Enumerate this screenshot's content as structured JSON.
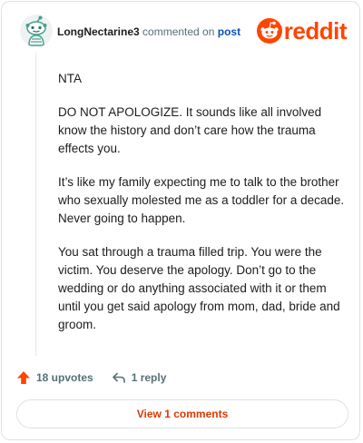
{
  "comment": {
    "username": "LongNectarine3",
    "commented_text": "commented on",
    "post_link": "post",
    "brand": "reddit",
    "paragraphs": [
      "NTA",
      "DO NOT APOLOGIZE. It sounds like all involved know the history and don’t care how the trauma effects you.",
      "It’s like my family expecting me to talk to the brother who sexually molested me as a toddler for a decade. Never going to happen.",
      "You sat through a trauma filled trip. You were the victim. You deserve the apology. Don’t go to the wedding or do anything associated with it or them until you get said apology from mom, dad, bride and groom."
    ]
  },
  "actions": {
    "upvotes": "18 upvotes",
    "replies": "1 reply",
    "view_comments": "View 1 comments"
  },
  "colors": {
    "brand_orange": "#ff4500",
    "link_blue": "#0b51b7",
    "view_button_text": "#d93900",
    "muted_text": "#576f76",
    "avatar_teal": "#46a18f"
  },
  "icons": {
    "avatar": "snoo-avatar-icon",
    "logo": "reddit-snoo-icon",
    "upvote": "upvote-arrow-icon",
    "reply": "reply-arrow-icon"
  }
}
